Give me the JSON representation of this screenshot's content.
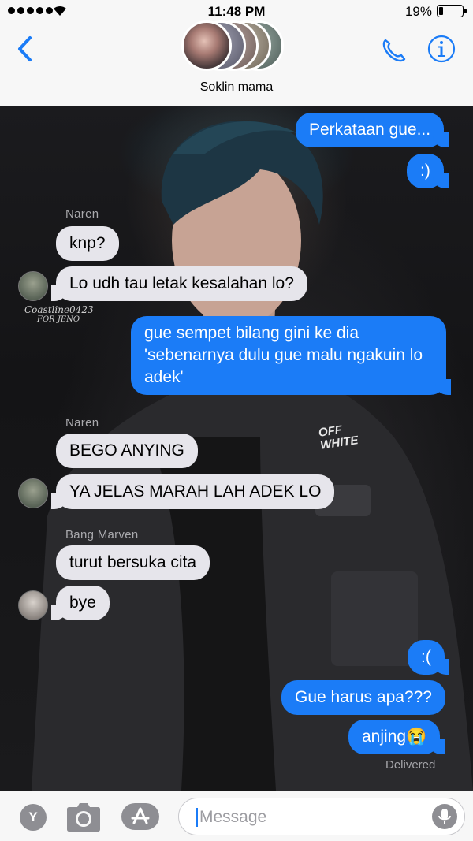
{
  "status_bar": {
    "time": "11:48 PM",
    "battery_percent": "19%",
    "battery_level": 0.19
  },
  "header": {
    "group_name": "Soklin mama",
    "accent_color": "#1b7cf7"
  },
  "messages": [
    {
      "dir": "out",
      "text": "Perkataan gue..."
    },
    {
      "dir": "out",
      "text": ":)"
    },
    {
      "dir": "in",
      "sender": "Naren",
      "text": "knp?"
    },
    {
      "dir": "in",
      "text": "Lo udh tau letak kesalahan lo?"
    },
    {
      "dir": "out",
      "text": "gue sempet bilang gini ke dia 'sebenarnya dulu gue malu ngakuin lo adek'"
    },
    {
      "dir": "in",
      "sender": "Naren",
      "text": "BEGO ANYING"
    },
    {
      "dir": "in",
      "text": "YA JELAS MARAH LAH ADEK LO"
    },
    {
      "dir": "in",
      "sender": "Bang Marven",
      "text": "turut bersuka cita"
    },
    {
      "dir": "in",
      "text": "bye"
    },
    {
      "dir": "out",
      "text": ":("
    },
    {
      "dir": "out",
      "text": "Gue harus apa???"
    },
    {
      "dir": "out",
      "text": "anjing😭"
    }
  ],
  "watermark": {
    "line1": "Coastline0423",
    "line2": "FOR JENO"
  },
  "receipt": "Delivered",
  "jacket_patch_text": "OFF WHITE",
  "compose": {
    "placeholder": "Message",
    "apps": [
      "y-app-icon",
      "camera-icon",
      "app-store-icon"
    ]
  },
  "colors": {
    "incoming_bubble": "#e6e5eb",
    "outgoing_bubble": "#1b7cf7",
    "header_bg": "#f7f7f7"
  }
}
